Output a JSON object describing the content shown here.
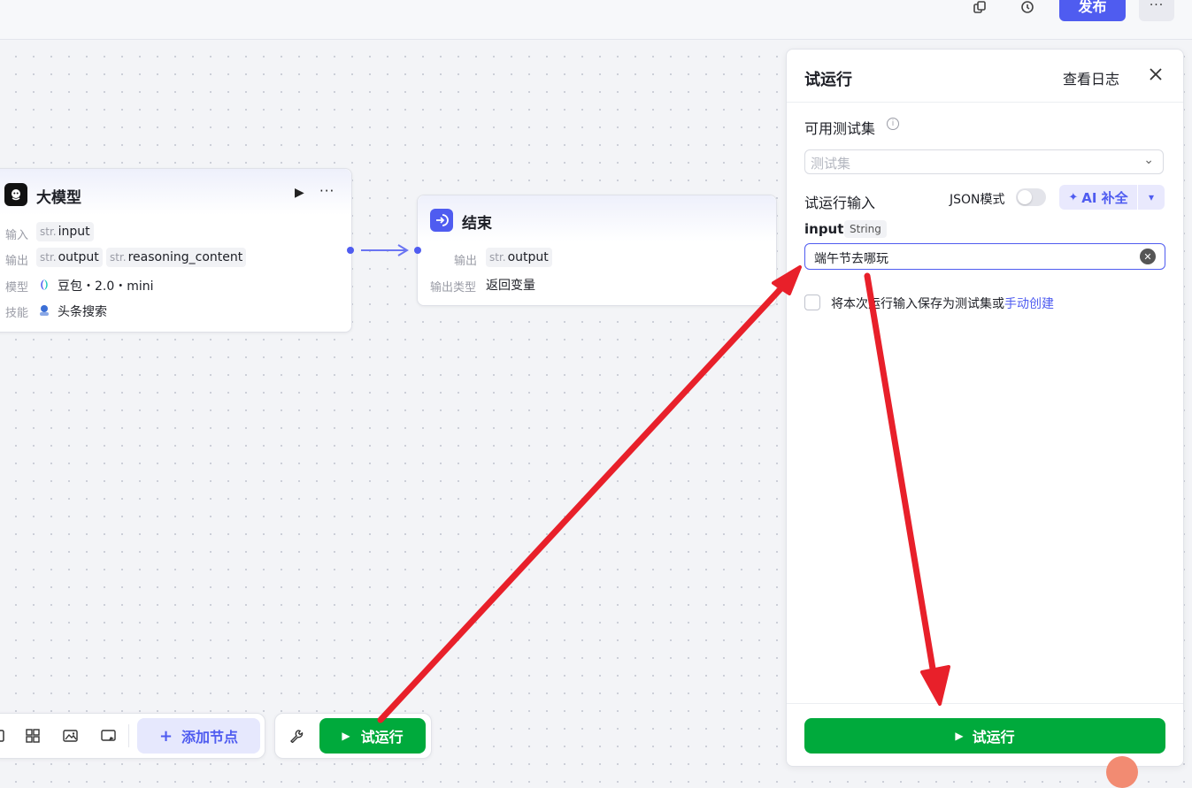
{
  "topbar": {
    "publish_label": "发布",
    "more_label": "···"
  },
  "llm_node": {
    "title": "大模型",
    "more_label": "···",
    "input_label": "输入",
    "input_var": "input",
    "output_label": "输出",
    "output_vars": [
      "output",
      "reasoning_content"
    ],
    "type_prefix": "str.",
    "model_label": "模型",
    "model_value": "豆包・2.0・mini",
    "skill_label": "技能",
    "skill_value": "头条搜索"
  },
  "end_node": {
    "title": "结束",
    "output_label": "输出",
    "output_var": "output",
    "type_prefix": "str.",
    "output_type_label": "输出类型",
    "output_type_value": "返回变量"
  },
  "panel": {
    "title": "试运行",
    "view_log": "查看日志",
    "testset_label": "可用测试集",
    "testset_placeholder": "测试集",
    "run_input_label": "试运行输入",
    "json_mode_label": "JSON模式",
    "json_mode_on": false,
    "ai_complete_label": "AI 补全",
    "field_name": "input",
    "field_type": "String",
    "field_value": "端午节去哪玩",
    "save_text": "将本次运行输入保存为测试集或",
    "save_link": "手动创建",
    "run_button": "试运行"
  },
  "toolbar": {
    "add_node_label": "添加节点",
    "run_label": "试运行"
  },
  "colors": {
    "accent": "#4f5cf0",
    "run_green": "#00aa3c",
    "annotation_red": "#e8202a"
  }
}
